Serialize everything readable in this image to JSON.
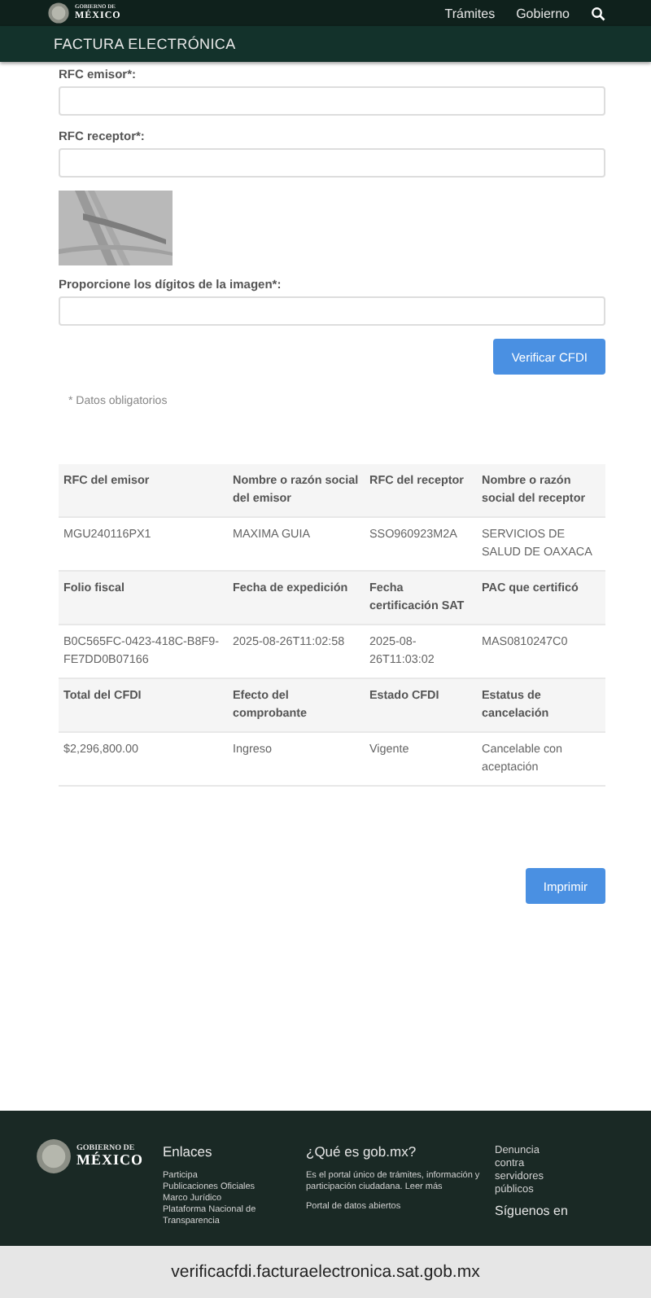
{
  "topbar": {
    "brand_small": "GOBIERNO DE",
    "brand_big": "MÉXICO",
    "nav": [
      "Trámites",
      "Gobierno"
    ]
  },
  "subheader": {
    "title": "FACTURA ELECTRÓNICA"
  },
  "form": {
    "fields": [
      {
        "label": "RFC emisor*:",
        "kind": "text"
      },
      {
        "label": "RFC receptor*:",
        "kind": "text"
      },
      {
        "kind": "captcha"
      },
      {
        "label": "Proporcione los dígitos de la imagen*:",
        "kind": "text"
      }
    ],
    "button": "Verificar CFDI",
    "note": "* Datos obligatorios"
  },
  "table": {
    "sections": [
      {
        "headers": [
          "RFC del emisor",
          "Nombre o razón social del emisor",
          "RFC del receptor",
          "Nombre o razón social del receptor"
        ],
        "values": [
          "MGU240116PX1",
          "MAXIMA GUIA",
          "SSO960923M2A",
          "SERVICIOS DE SALUD DE OAXACA"
        ]
      },
      {
        "headers": [
          "Folio fiscal",
          "Fecha de expedición",
          "Fecha certificación SAT",
          "PAC que certificó"
        ],
        "values": [
          "B0C565FC-0423-418C-B8F9-FE7DD0B07166",
          "2025-08-26T11:02:58",
          "2025-08-26T11:03:02",
          "MAS0810247C0"
        ]
      },
      {
        "headers": [
          "Total del CFDI",
          "Efecto del comprobante",
          "Estado CFDI",
          "Estatus de cancelación"
        ],
        "values": [
          "$2,296,800.00",
          "Ingreso",
          "Vigente",
          "Cancelable con aceptación"
        ]
      }
    ]
  },
  "print_button": "Imprimir",
  "footer": {
    "brand_small": "GOBIERNO DE",
    "brand_big": "MÉXICO",
    "links_title": "Enlaces",
    "links": [
      "Participa",
      "Publicaciones Oficiales",
      "Marco Jurídico",
      "Plataforma Nacional de Transparencia"
    ],
    "about_title": "¿Qué es gob.mx?",
    "about_text": "Es el portal único de trámites, información y participación ciudadana. Leer más",
    "about_link": "Portal de datos abiertos",
    "denuncia": "Denuncia contra servidores públicos",
    "follow": "Síguenos en"
  },
  "browser": {
    "url": "verificacfdi.facturaelectronica.sat.gob.mx"
  }
}
